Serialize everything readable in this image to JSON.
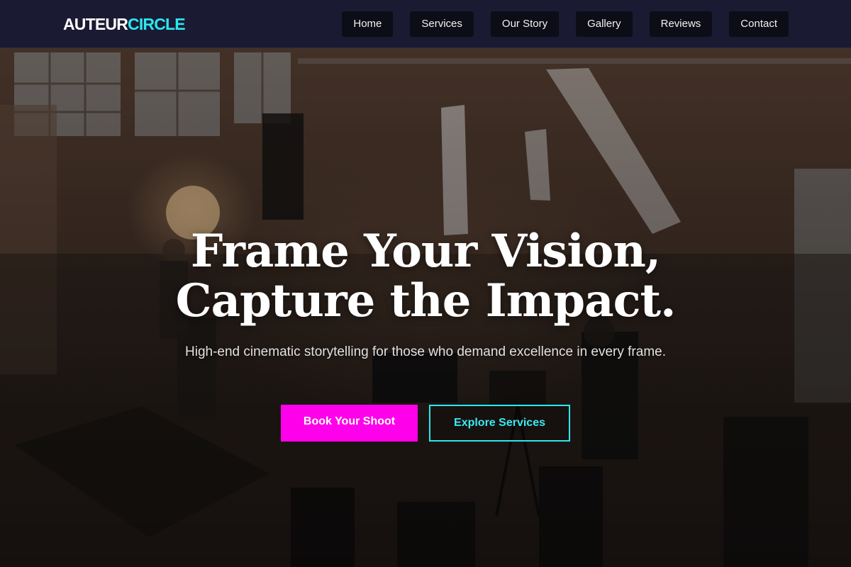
{
  "brand": {
    "part1": "AUTEUR",
    "part2": "CIRCLE",
    "accent_color": "#2ae8f0"
  },
  "nav": {
    "items": [
      {
        "label": "Home"
      },
      {
        "label": "Services"
      },
      {
        "label": "Our Story"
      },
      {
        "label": "Gallery"
      },
      {
        "label": "Reviews"
      },
      {
        "label": "Contact"
      }
    ]
  },
  "hero": {
    "title_line1": "Frame Your Vision,",
    "title_line2": "Capture the Impact.",
    "subtitle": "High-end cinematic storytelling for those who demand excellence in every frame.",
    "primary_cta": "Book Your Shoot",
    "secondary_cta": "Explore Services",
    "primary_color": "#ff00ea",
    "secondary_color": "#2ae8f0"
  }
}
